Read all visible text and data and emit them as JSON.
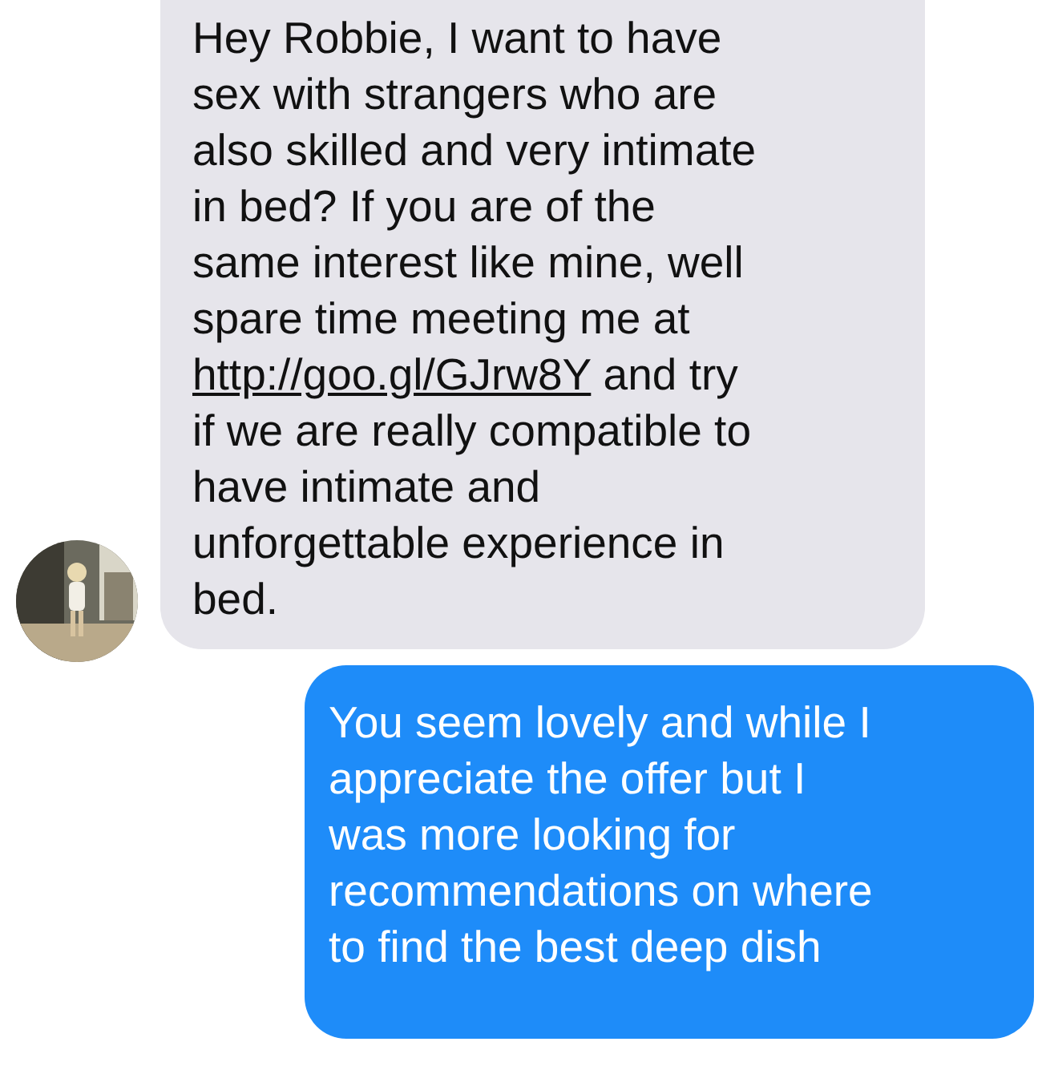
{
  "messages": [
    {
      "kind": "received",
      "parts": [
        {
          "kind": "text",
          "text": "Hey Robbie, I want to have\nsex with strangers who are\nalso skilled and very intimate\nin bed? If you are of the\nsame interest like mine, well\nspare time meeting me at\n"
        },
        {
          "kind": "link",
          "text": "http://goo.gl/GJrw8Y"
        },
        {
          "kind": "text",
          "text": " and try\nif we are really compatible to\nhave intimate and\nunforgettable experience in\nbed."
        }
      ]
    },
    {
      "kind": "sent",
      "parts": [
        {
          "kind": "text",
          "text": "You seem lovely and while I\nappreciate the offer but I\nwas more looking for\nrecommendations on where\nto find the best deep dish"
        }
      ]
    }
  ]
}
